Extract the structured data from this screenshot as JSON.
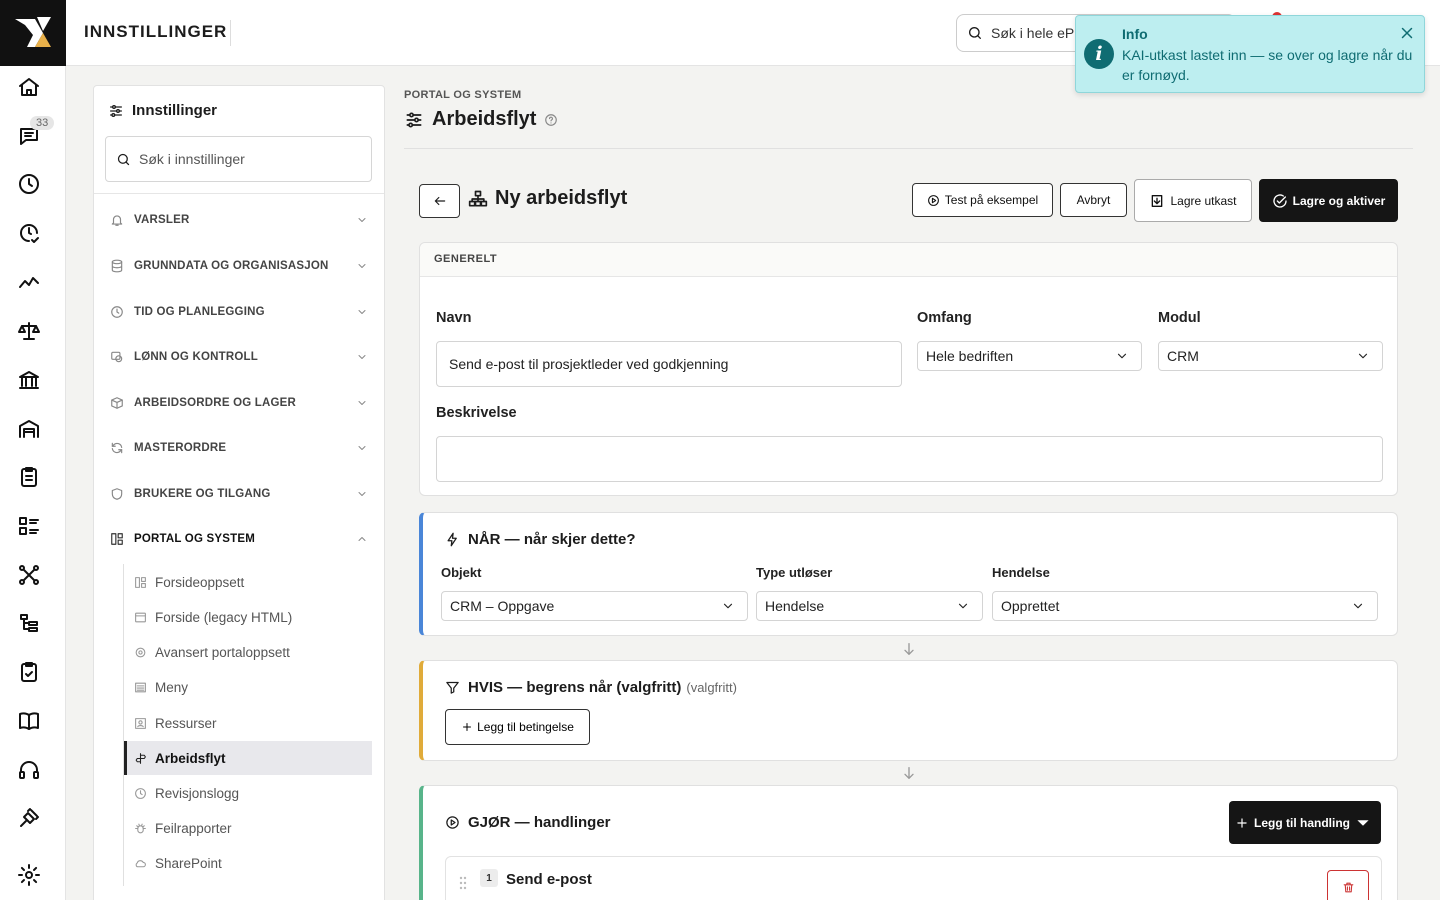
{
  "rail": {
    "items": [
      {
        "name": "home-icon"
      },
      {
        "name": "chat-icon",
        "badge": "33"
      },
      {
        "name": "clock-icon"
      },
      {
        "name": "clock-check-icon"
      },
      {
        "name": "trend-line-icon"
      },
      {
        "name": "scale-icon"
      },
      {
        "name": "bank-icon"
      },
      {
        "name": "warehouse-icon"
      },
      {
        "name": "clipboard-list-icon"
      },
      {
        "name": "list-details-icon"
      },
      {
        "name": "network-icon"
      },
      {
        "name": "hierarchy-icon"
      },
      {
        "name": "clipboard-check-icon"
      },
      {
        "name": "book-icon"
      },
      {
        "name": "headset-icon"
      },
      {
        "name": "plug-icon"
      },
      {
        "name": "gear-icon"
      }
    ]
  },
  "topbar": {
    "title": "INNSTILLINGER",
    "search_placeholder": "Søk i hele eP"
  },
  "toast": {
    "title": "Info",
    "message": "KAI-utkast lastet inn — se over og lagre når du er fornøyd."
  },
  "sidebar": {
    "title": "Innstillinger",
    "search_placeholder": "Søk i innstillinger",
    "sections": [
      {
        "label": "VARSLER",
        "icon": "bell-icon"
      },
      {
        "label": "GRUNNDATA OG ORGANISASJON",
        "icon": "database-icon"
      },
      {
        "label": "TID OG PLANLEGGING",
        "icon": "clock-icon"
      },
      {
        "label": "LØNN OG KONTROLL",
        "icon": "payroll-icon"
      },
      {
        "label": "ARBEIDSORDRE OG LAGER",
        "icon": "box-icon"
      },
      {
        "label": "MASTERORDRE",
        "icon": "refresh-icon"
      },
      {
        "label": "BRUKERE OG TILGANG",
        "icon": "shield-icon"
      },
      {
        "label": "PORTAL OG SYSTEM",
        "icon": "layout-icon"
      }
    ],
    "sub_items": [
      {
        "label": "Forsideoppsett",
        "icon": "layout-icon"
      },
      {
        "label": "Forside (legacy HTML)",
        "icon": "browser-icon"
      },
      {
        "label": "Avansert portaloppsett",
        "icon": "cog-icon"
      },
      {
        "label": "Meny",
        "icon": "menu-icon"
      },
      {
        "label": "Ressurser",
        "icon": "user-card-icon"
      },
      {
        "label": "Arbeidsflyt",
        "icon": "workflow-icon"
      },
      {
        "label": "Revisjonslogg",
        "icon": "history-icon"
      },
      {
        "label": "Feilrapporter",
        "icon": "bug-icon"
      },
      {
        "label": "SharePoint",
        "icon": "cloud-icon"
      }
    ]
  },
  "main": {
    "breadcrumb": "PORTAL OG SYSTEM",
    "title": "Arbeidsflyt",
    "workflow_title": "Ny arbeidsflyt",
    "buttons": {
      "test": "Test på eksempel",
      "cancel": "Avbryt",
      "draft": "Lagre utkast",
      "activate": "Lagre og aktiver"
    },
    "general": {
      "header": "GENERELT",
      "name_label": "Navn",
      "name_value": "Send e-post til prosjektleder ved godkjenning",
      "scope_label": "Omfang",
      "scope_value": "Hele bedriften",
      "module_label": "Modul",
      "module_value": "CRM",
      "description_label": "Beskrivelse",
      "description_value": ""
    },
    "when": {
      "title": "NÅR — når skjer dette?",
      "object_label": "Objekt",
      "object_value": "CRM – Oppgave",
      "trigger_label": "Type utløser",
      "trigger_value": "Hendelse",
      "event_label": "Hendelse",
      "event_value": "Opprettet",
      "accent": "#4a86d8"
    },
    "if": {
      "title": "HVIS — begrens når (valgfritt)",
      "optional": "(valgfritt)",
      "add_condition": "Legg til betingelse",
      "accent": "#e0ab3a"
    },
    "do": {
      "title": "GJØR — handlinger",
      "add_action": "Legg til handling",
      "accent": "#58b48a",
      "actions": [
        {
          "number": "1",
          "title": "Send e-post"
        }
      ]
    }
  }
}
